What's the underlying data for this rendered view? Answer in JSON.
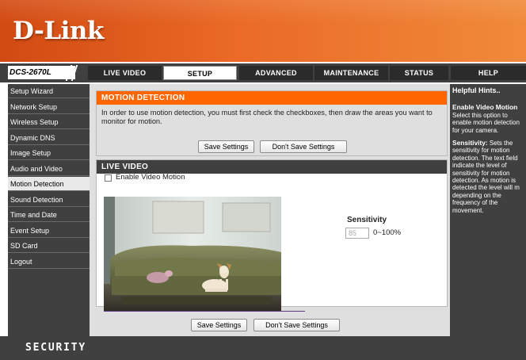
{
  "brand": {
    "logo": "D-Link",
    "model": "DCS-2670L"
  },
  "nav": {
    "tabs": [
      {
        "label": "LIVE VIDEO"
      },
      {
        "label": "SETUP"
      },
      {
        "label": "ADVANCED"
      },
      {
        "label": "MAINTENANCE"
      },
      {
        "label": "STATUS"
      },
      {
        "label": "HELP"
      }
    ],
    "active_tab": "SETUP"
  },
  "sidebar": {
    "items": [
      {
        "label": "Setup Wizard"
      },
      {
        "label": "Network Setup"
      },
      {
        "label": "Wireless Setup"
      },
      {
        "label": "Dynamic DNS"
      },
      {
        "label": "Image Setup"
      },
      {
        "label": "Audio and Video"
      },
      {
        "label": "Motion Detection"
      },
      {
        "label": "Sound Detection"
      },
      {
        "label": "Time and Date"
      },
      {
        "label": "Event Setup"
      },
      {
        "label": "SD Card"
      },
      {
        "label": "Logout"
      }
    ],
    "active_item": "Motion Detection"
  },
  "motion_panel": {
    "title": "MOTION DETECTION",
    "description": "In order to use motion detection, you must first check the checkboxes, then draw the areas you want to monitor for motion.",
    "save_label": "Save Settings",
    "dont_save_label": "Don't Save Settings"
  },
  "live_panel": {
    "title": "LIVE VIDEO",
    "enable_label": "Enable Video Motion",
    "enable_checked": false,
    "sensitivity_label": "Sensitivity",
    "sensitivity_value": "85",
    "sensitivity_range": "0~100%"
  },
  "bottom_buttons": {
    "save_label": "Save Settings",
    "dont_save_label": "Don't Save Settings"
  },
  "hints": {
    "title": "Helpful Hints..",
    "items": [
      {
        "heading": "Enable Video Motion",
        "lines": [
          "Select this option to",
          "enable motion detection",
          "for your camera."
        ]
      },
      {
        "heading": "Sensitivity:",
        "lines": [
          " Sets the",
          "sensitivity for motion",
          "detection. The text field",
          "indicate the level of",
          "sensitivity for motion",
          "detection. As motion is",
          "detected the level will m",
          "depending on the",
          "frequency of the",
          "movement."
        ]
      }
    ]
  },
  "footer": {
    "text": "SECURITY"
  },
  "colors": {
    "header_orange": "#e8641e",
    "panel_orange": "#ff6600",
    "dark_bar": "#404040"
  }
}
